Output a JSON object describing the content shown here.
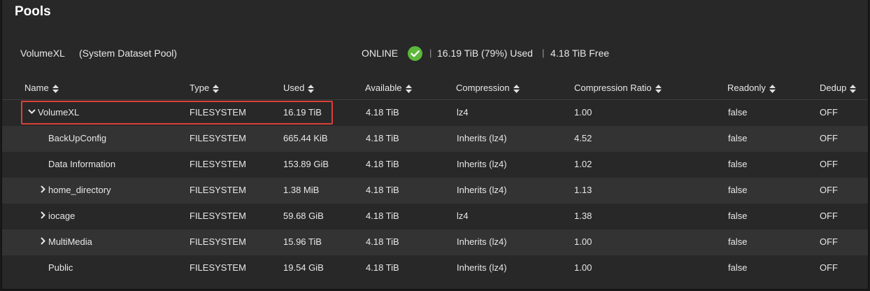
{
  "page": {
    "title": "Pools"
  },
  "pool": {
    "name": "VolumeXL",
    "note": "(System Dataset Pool)",
    "status": "ONLINE",
    "separator": "|",
    "used": "16.19 TiB (79%) Used",
    "free": "4.18 TiB Free",
    "status_color": "#5bb83a"
  },
  "table": {
    "columns": [
      "Name",
      "Type",
      "Used",
      "Available",
      "Compression",
      "Compression Ratio",
      "Readonly",
      "Dedup"
    ],
    "rows": [
      {
        "name": "VolumeXL",
        "expander": "expanded",
        "type": "FILESYSTEM",
        "used": "16.19 TiB",
        "available": "4.18 TiB",
        "compression": "lz4",
        "ratio": "1.00",
        "readonly": "false",
        "dedup": "OFF"
      },
      {
        "name": "BackUpConfig",
        "expander": "none",
        "type": "FILESYSTEM",
        "used": "665.44 KiB",
        "available": "4.18 TiB",
        "compression": "Inherits (lz4)",
        "ratio": "4.52",
        "readonly": "false",
        "dedup": "OFF"
      },
      {
        "name": "Data Information",
        "expander": "none",
        "type": "FILESYSTEM",
        "used": "153.89 GiB",
        "available": "4.18 TiB",
        "compression": "Inherits (lz4)",
        "ratio": "1.02",
        "readonly": "false",
        "dedup": "OFF"
      },
      {
        "name": "home_directory",
        "expander": "collapsed",
        "type": "FILESYSTEM",
        "used": "1.38 MiB",
        "available": "4.18 TiB",
        "compression": "Inherits (lz4)",
        "ratio": "1.13",
        "readonly": "false",
        "dedup": "OFF"
      },
      {
        "name": "iocage",
        "expander": "collapsed",
        "type": "FILESYSTEM",
        "used": "59.68 GiB",
        "available": "4.18 TiB",
        "compression": "lz4",
        "ratio": "1.38",
        "readonly": "false",
        "dedup": "OFF"
      },
      {
        "name": "MultiMedia",
        "expander": "collapsed",
        "type": "FILESYSTEM",
        "used": "15.96 TiB",
        "available": "4.18 TiB",
        "compression": "Inherits (lz4)",
        "ratio": "1.00",
        "readonly": "false",
        "dedup": "OFF"
      },
      {
        "name": "Public",
        "expander": "none",
        "type": "FILESYSTEM",
        "used": "19.54 GiB",
        "available": "4.18 TiB",
        "compression": "Inherits (lz4)",
        "ratio": "1.00",
        "readonly": "false",
        "dedup": "OFF"
      }
    ]
  },
  "annotation": {
    "highlight_color": "#d9413a"
  }
}
